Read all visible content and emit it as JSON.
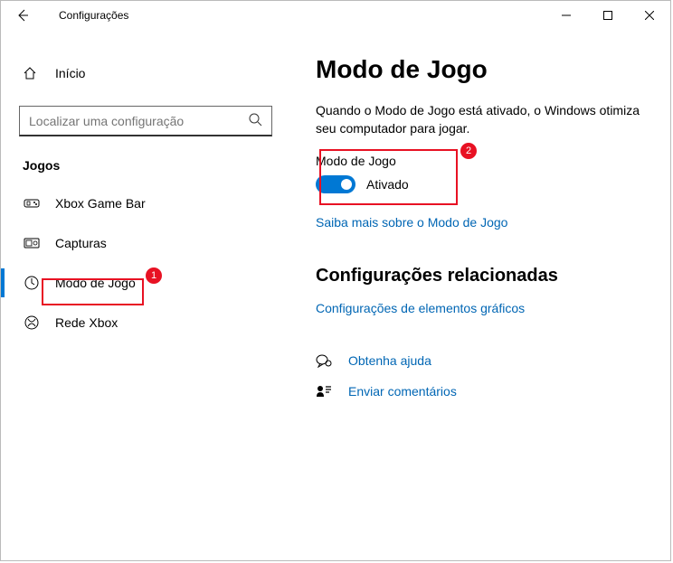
{
  "window": {
    "title": "Configurações"
  },
  "sidebar": {
    "home": "Início",
    "search_placeholder": "Localizar uma configuração",
    "section": "Jogos",
    "items": [
      {
        "label": "Xbox Game Bar"
      },
      {
        "label": "Capturas"
      },
      {
        "label": "Modo de Jogo"
      },
      {
        "label": "Rede Xbox"
      }
    ]
  },
  "main": {
    "title": "Modo de Jogo",
    "description": "Quando o Modo de Jogo está ativado, o Windows otimiza seu computador para jogar.",
    "toggle_section_label": "Modo de Jogo",
    "toggle_state_label": "Ativado",
    "learn_more": "Saiba mais sobre o Modo de Jogo",
    "related_heading": "Configurações relacionadas",
    "related_link": "Configurações de elementos gráficos",
    "help": "Obtenha ajuda",
    "feedback": "Enviar comentários"
  },
  "annotations": {
    "badge1": "1",
    "badge2": "2"
  }
}
